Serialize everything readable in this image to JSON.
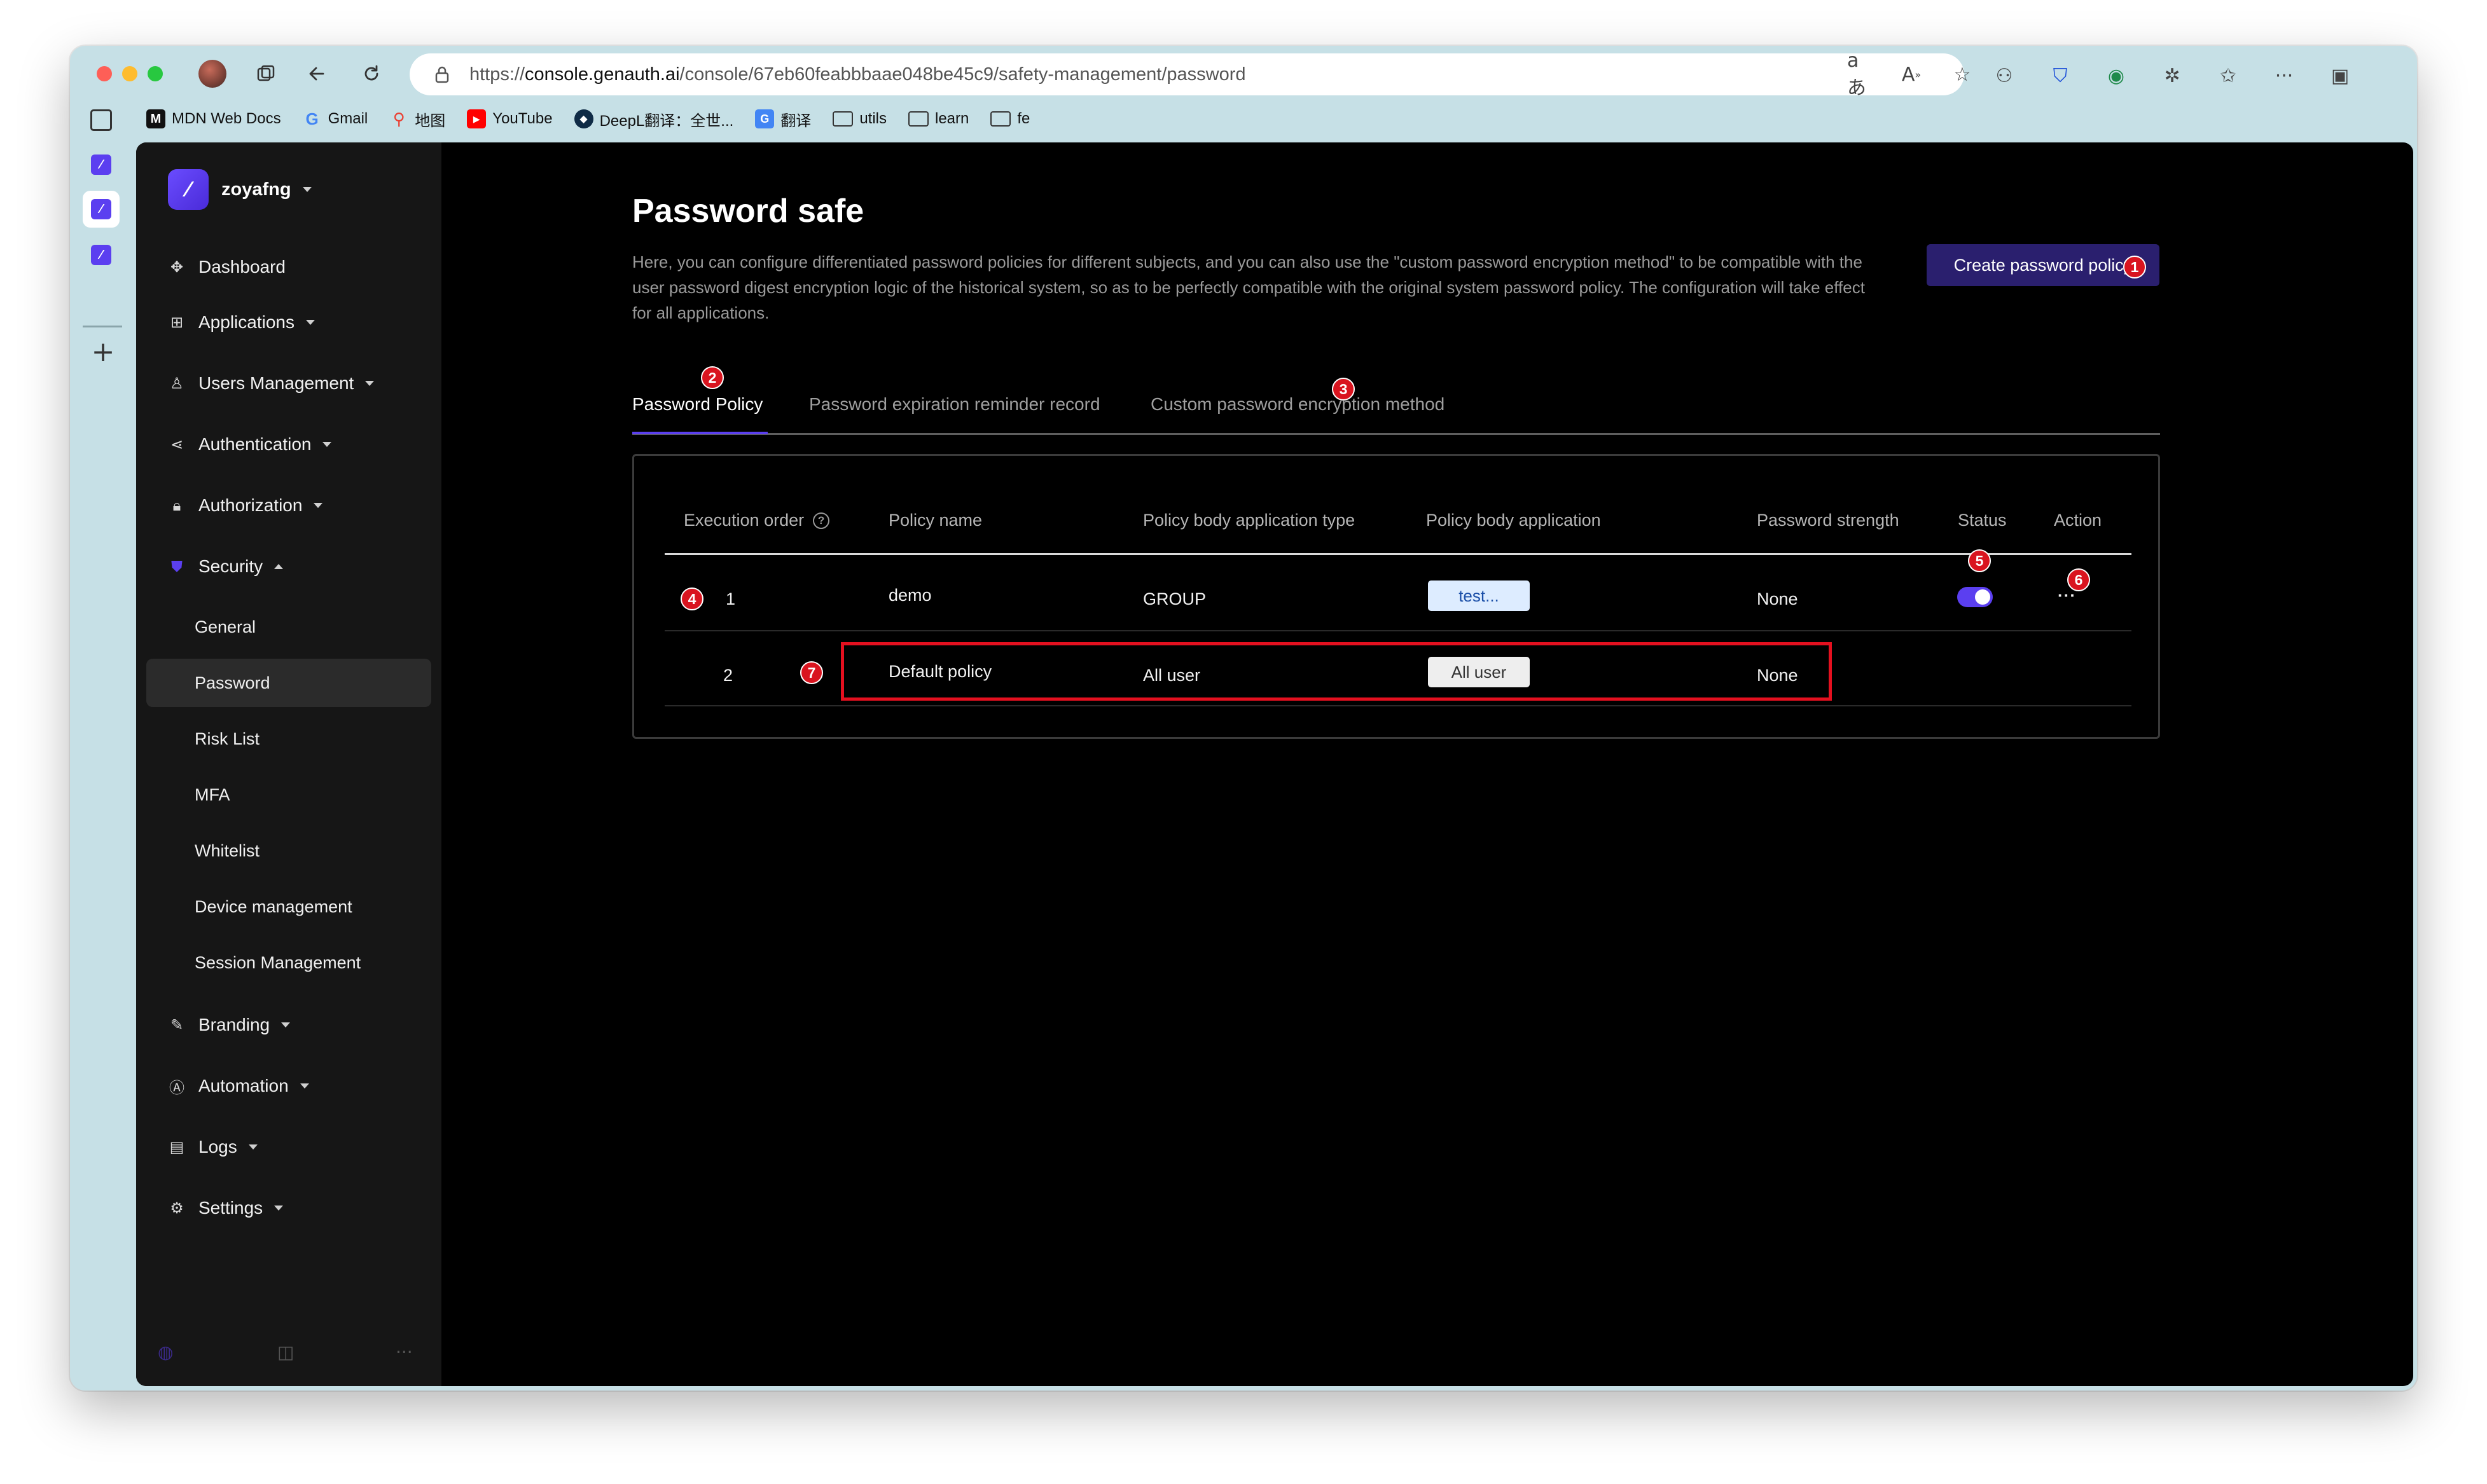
{
  "browser": {
    "url_prefix": "https://",
    "url_host": "console.genauth.ai",
    "url_path": "/console/67eb60feabbbaae048be45c9/safety-management/password",
    "bookmarks": [
      {
        "label": "MDN Web Docs",
        "icon": "mdn-icon"
      },
      {
        "label": "Gmail",
        "icon": "google-icon"
      },
      {
        "label": "地图",
        "icon": "maps-icon"
      },
      {
        "label": "YouTube",
        "icon": "youtube-icon"
      },
      {
        "label": "DeepL翻译：全世...",
        "icon": "deepl-icon"
      },
      {
        "label": "翻译",
        "icon": "translate-icon"
      },
      {
        "label": "utils",
        "icon": "folder-icon"
      },
      {
        "label": "learn",
        "icon": "folder-icon"
      },
      {
        "label": "fe",
        "icon": "folder-icon"
      }
    ]
  },
  "sidebar": {
    "org_name": "zoyafng",
    "nav": [
      {
        "label": "Dashboard",
        "icon": "dashboard-icon",
        "has_caret": false
      },
      {
        "label": "Applications",
        "icon": "applications-icon",
        "has_caret": true
      },
      {
        "label": "Users Management",
        "icon": "users-icon",
        "has_caret": true
      },
      {
        "label": "Authentication",
        "icon": "share-icon",
        "has_caret": true
      },
      {
        "label": "Authorization",
        "icon": "lock-icon",
        "has_caret": true
      },
      {
        "label": "Security",
        "icon": "shield-icon",
        "has_caret": true,
        "expanded": true
      }
    ],
    "security_sub": [
      "General",
      "Password",
      "Risk List",
      "MFA",
      "Whitelist",
      "Device management",
      "Session Management"
    ],
    "active_sub": "Password",
    "nav_bottom": [
      {
        "label": "Branding",
        "icon": "brush-icon"
      },
      {
        "label": "Automation",
        "icon": "automation-icon"
      },
      {
        "label": "Logs",
        "icon": "logs-icon"
      },
      {
        "label": "Settings",
        "icon": "gear-icon"
      }
    ]
  },
  "page": {
    "title": "Password safe",
    "description": "Here, you can configure differentiated password policies for different subjects, and you can also use the \"custom password encryption method\" to be compatible with the user password digest encryption logic of the historical system, so as to be perfectly compatible with the original system password policy. The configuration will take effect for all applications.",
    "create_button": "Create password policy",
    "tabs": [
      "Password Policy",
      "Password expiration reminder record",
      "Custom password encryption method"
    ],
    "active_tab": 0
  },
  "table": {
    "headers": [
      "Execution order",
      "Policy name",
      "Policy body application type",
      "Policy body application",
      "Password strength",
      "Status",
      "Action"
    ],
    "rows": [
      {
        "order": "1",
        "name": "demo",
        "type": "GROUP",
        "application": "test...",
        "strength": "None",
        "status_on": true,
        "action": "···"
      },
      {
        "order": "2",
        "name": "Default policy",
        "type": "All user",
        "application": "All user",
        "strength": "None"
      }
    ]
  },
  "annotations": [
    "1",
    "2",
    "3",
    "4",
    "5",
    "6",
    "7"
  ],
  "colors": {
    "accent": "#5b3ff0",
    "marker": "#d9141f",
    "window_bg": "#c6e0e6"
  }
}
